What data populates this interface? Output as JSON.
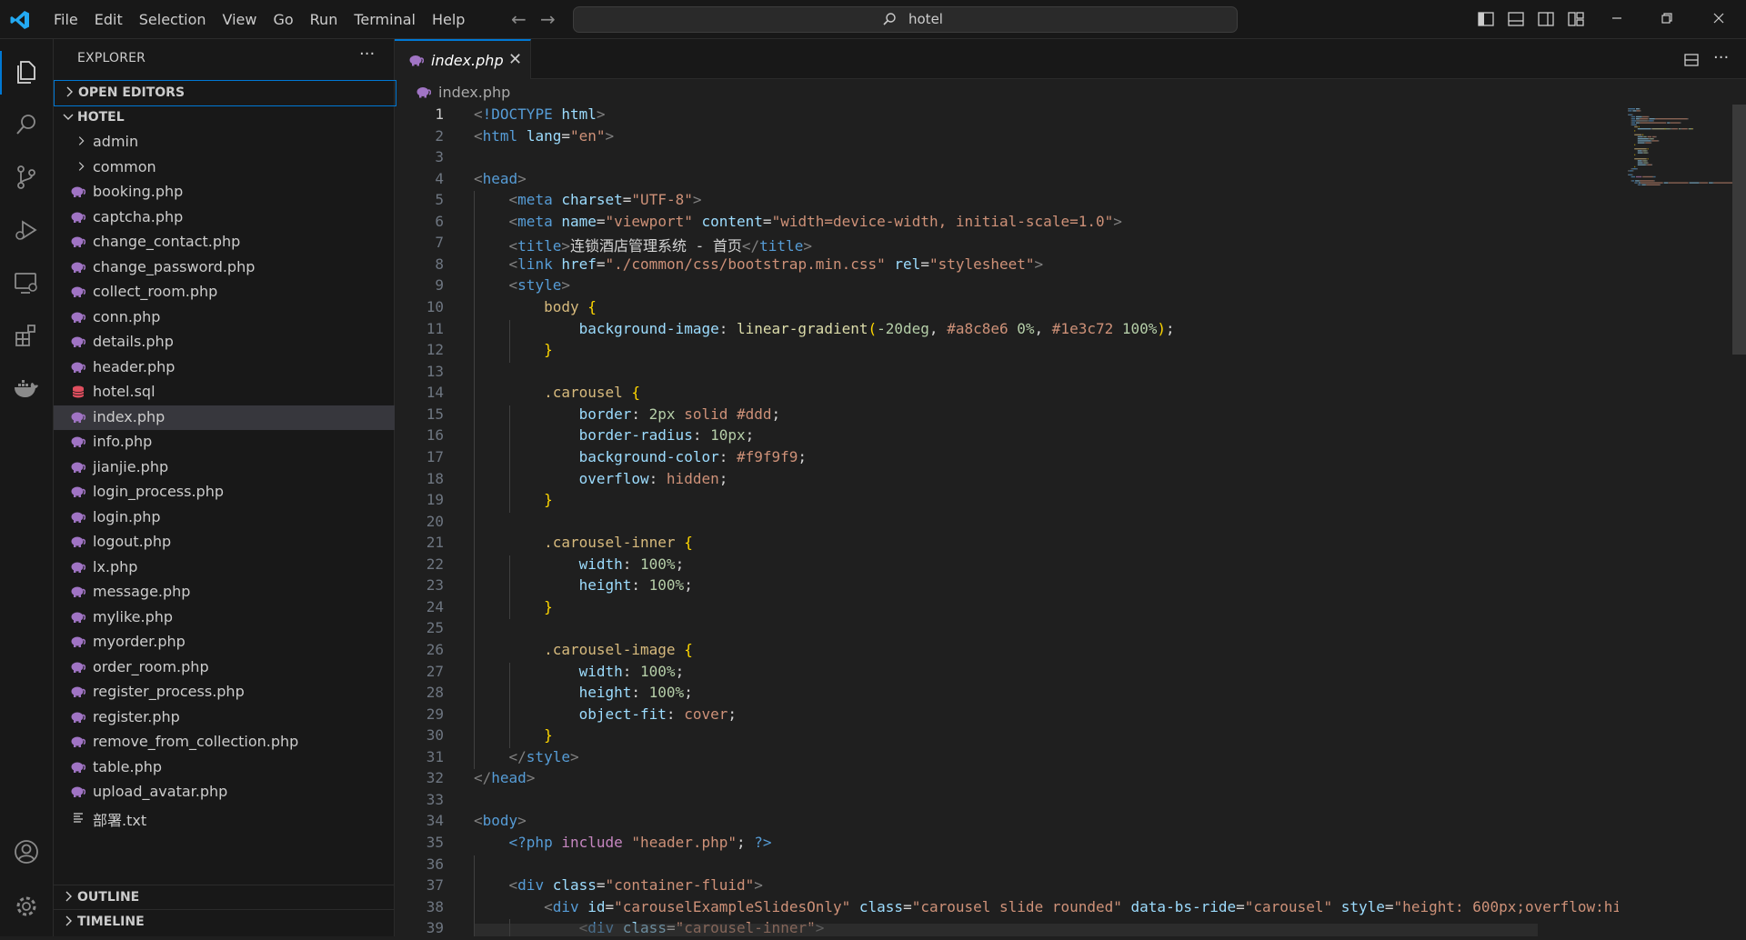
{
  "menu": [
    "File",
    "Edit",
    "Selection",
    "View",
    "Go",
    "Run",
    "Terminal",
    "Help"
  ],
  "search": {
    "text": "hotel"
  },
  "sidebar": {
    "title": "EXPLORER",
    "open_editors": "OPEN EDITORS",
    "root": "HOTEL",
    "folders": [
      "admin",
      "common"
    ],
    "files": [
      {
        "name": "booking.php",
        "type": "php"
      },
      {
        "name": "captcha.php",
        "type": "php"
      },
      {
        "name": "change_contact.php",
        "type": "php"
      },
      {
        "name": "change_password.php",
        "type": "php"
      },
      {
        "name": "collect_room.php",
        "type": "php"
      },
      {
        "name": "conn.php",
        "type": "php"
      },
      {
        "name": "details.php",
        "type": "php"
      },
      {
        "name": "header.php",
        "type": "php"
      },
      {
        "name": "hotel.sql",
        "type": "sql"
      },
      {
        "name": "index.php",
        "type": "php",
        "selected": true
      },
      {
        "name": "info.php",
        "type": "php"
      },
      {
        "name": "jianjie.php",
        "type": "php"
      },
      {
        "name": "login_process.php",
        "type": "php"
      },
      {
        "name": "login.php",
        "type": "php"
      },
      {
        "name": "logout.php",
        "type": "php"
      },
      {
        "name": "lx.php",
        "type": "php"
      },
      {
        "name": "message.php",
        "type": "php"
      },
      {
        "name": "mylike.php",
        "type": "php"
      },
      {
        "name": "myorder.php",
        "type": "php"
      },
      {
        "name": "order_room.php",
        "type": "php"
      },
      {
        "name": "register_process.php",
        "type": "php"
      },
      {
        "name": "register.php",
        "type": "php"
      },
      {
        "name": "remove_from_collection.php",
        "type": "php"
      },
      {
        "name": "table.php",
        "type": "php"
      },
      {
        "name": "upload_avatar.php",
        "type": "php"
      },
      {
        "name": "部署.txt",
        "type": "txt"
      }
    ],
    "outline": "OUTLINE",
    "timeline": "TIMELINE"
  },
  "tab": {
    "label": "index.php"
  },
  "breadcrumb": "index.php",
  "editor": {
    "current_line": 1,
    "lines": [
      [
        [
          "br",
          "<"
        ],
        [
          "tag",
          "!DOCTYPE"
        ],
        [
          "pl",
          " "
        ],
        [
          "attr",
          "html"
        ],
        [
          "br",
          ">"
        ]
      ],
      [
        [
          "br",
          "<"
        ],
        [
          "tag",
          "html"
        ],
        [
          "pl",
          " "
        ],
        [
          "attr",
          "lang"
        ],
        [
          "pl",
          "="
        ],
        [
          "str",
          "\"en\""
        ],
        [
          "br",
          ">"
        ]
      ],
      [],
      [
        [
          "br",
          "<"
        ],
        [
          "tag",
          "head"
        ],
        [
          "br",
          ">"
        ]
      ],
      [
        [
          "pl",
          "    "
        ],
        [
          "br",
          "<"
        ],
        [
          "tag",
          "meta"
        ],
        [
          "pl",
          " "
        ],
        [
          "attr",
          "charset"
        ],
        [
          "pl",
          "="
        ],
        [
          "str",
          "\"UTF-8\""
        ],
        [
          "br",
          ">"
        ]
      ],
      [
        [
          "pl",
          "    "
        ],
        [
          "br",
          "<"
        ],
        [
          "tag",
          "meta"
        ],
        [
          "pl",
          " "
        ],
        [
          "attr",
          "name"
        ],
        [
          "pl",
          "="
        ],
        [
          "str",
          "\"viewport\""
        ],
        [
          "pl",
          " "
        ],
        [
          "attr",
          "content"
        ],
        [
          "pl",
          "="
        ],
        [
          "str",
          "\"width=device-width, initial-scale=1.0\""
        ],
        [
          "br",
          ">"
        ]
      ],
      [
        [
          "pl",
          "    "
        ],
        [
          "br",
          "<"
        ],
        [
          "tag",
          "title"
        ],
        [
          "br",
          ">"
        ],
        [
          "pl",
          "连锁酒店管理系统 - 首页"
        ],
        [
          "br",
          "</"
        ],
        [
          "tag",
          "title"
        ],
        [
          "br",
          ">"
        ]
      ],
      [
        [
          "pl",
          "    "
        ],
        [
          "br",
          "<"
        ],
        [
          "tag",
          "link"
        ],
        [
          "pl",
          " "
        ],
        [
          "attr",
          "href"
        ],
        [
          "pl",
          "="
        ],
        [
          "str",
          "\"./common/css/bootstrap.min.css\""
        ],
        [
          "pl",
          " "
        ],
        [
          "attr",
          "rel"
        ],
        [
          "pl",
          "="
        ],
        [
          "str",
          "\"stylesheet\""
        ],
        [
          "br",
          ">"
        ]
      ],
      [
        [
          "pl",
          "    "
        ],
        [
          "br",
          "<"
        ],
        [
          "tag",
          "style"
        ],
        [
          "br",
          ">"
        ]
      ],
      [
        [
          "pl",
          "        "
        ],
        [
          "sel",
          "body"
        ],
        [
          "pl",
          " "
        ],
        [
          "brace",
          "{"
        ]
      ],
      [
        [
          "pl",
          "            "
        ],
        [
          "attr",
          "background-image"
        ],
        [
          "pl",
          ": "
        ],
        [
          "fn",
          "linear-gradient"
        ],
        [
          "brace",
          "("
        ],
        [
          "num",
          "-20deg"
        ],
        [
          "pl",
          ", "
        ],
        [
          "str",
          "#a8c8e6"
        ],
        [
          "pl",
          " "
        ],
        [
          "num",
          "0%"
        ],
        [
          "pl",
          ", "
        ],
        [
          "str",
          "#1e3c72"
        ],
        [
          "pl",
          " "
        ],
        [
          "num",
          "100%"
        ],
        [
          "brace",
          ")"
        ],
        [
          "pl",
          ";"
        ]
      ],
      [
        [
          "pl",
          "        "
        ],
        [
          "brace",
          "}"
        ]
      ],
      [],
      [
        [
          "pl",
          "        "
        ],
        [
          "sel",
          ".carousel"
        ],
        [
          "pl",
          " "
        ],
        [
          "brace",
          "{"
        ]
      ],
      [
        [
          "pl",
          "            "
        ],
        [
          "attr",
          "border"
        ],
        [
          "pl",
          ": "
        ],
        [
          "num",
          "2px"
        ],
        [
          "pl",
          " "
        ],
        [
          "str",
          "solid"
        ],
        [
          "pl",
          " "
        ],
        [
          "str",
          "#ddd"
        ],
        [
          "pl",
          ";"
        ]
      ],
      [
        [
          "pl",
          "            "
        ],
        [
          "attr",
          "border-radius"
        ],
        [
          "pl",
          ": "
        ],
        [
          "num",
          "10px"
        ],
        [
          "pl",
          ";"
        ]
      ],
      [
        [
          "pl",
          "            "
        ],
        [
          "attr",
          "background-color"
        ],
        [
          "pl",
          ": "
        ],
        [
          "str",
          "#f9f9f9"
        ],
        [
          "pl",
          ";"
        ]
      ],
      [
        [
          "pl",
          "            "
        ],
        [
          "attr",
          "overflow"
        ],
        [
          "pl",
          ": "
        ],
        [
          "str",
          "hidden"
        ],
        [
          "pl",
          ";"
        ]
      ],
      [
        [
          "pl",
          "        "
        ],
        [
          "brace",
          "}"
        ]
      ],
      [],
      [
        [
          "pl",
          "        "
        ],
        [
          "sel",
          ".carousel-inner"
        ],
        [
          "pl",
          " "
        ],
        [
          "brace",
          "{"
        ]
      ],
      [
        [
          "pl",
          "            "
        ],
        [
          "attr",
          "width"
        ],
        [
          "pl",
          ": "
        ],
        [
          "num",
          "100%"
        ],
        [
          "pl",
          ";"
        ]
      ],
      [
        [
          "pl",
          "            "
        ],
        [
          "attr",
          "height"
        ],
        [
          "pl",
          ": "
        ],
        [
          "num",
          "100%"
        ],
        [
          "pl",
          ";"
        ]
      ],
      [
        [
          "pl",
          "        "
        ],
        [
          "brace",
          "}"
        ]
      ],
      [],
      [
        [
          "pl",
          "        "
        ],
        [
          "sel",
          ".carousel-image"
        ],
        [
          "pl",
          " "
        ],
        [
          "brace",
          "{"
        ]
      ],
      [
        [
          "pl",
          "            "
        ],
        [
          "attr",
          "width"
        ],
        [
          "pl",
          ": "
        ],
        [
          "num",
          "100%"
        ],
        [
          "pl",
          ";"
        ]
      ],
      [
        [
          "pl",
          "            "
        ],
        [
          "attr",
          "height"
        ],
        [
          "pl",
          ": "
        ],
        [
          "num",
          "100%"
        ],
        [
          "pl",
          ";"
        ]
      ],
      [
        [
          "pl",
          "            "
        ],
        [
          "attr",
          "object-fit"
        ],
        [
          "pl",
          ": "
        ],
        [
          "str",
          "cover"
        ],
        [
          "pl",
          ";"
        ]
      ],
      [
        [
          "pl",
          "        "
        ],
        [
          "brace",
          "}"
        ]
      ],
      [
        [
          "pl",
          "    "
        ],
        [
          "br",
          "</"
        ],
        [
          "tag",
          "style"
        ],
        [
          "br",
          ">"
        ]
      ],
      [
        [
          "br",
          "</"
        ],
        [
          "tag",
          "head"
        ],
        [
          "br",
          ">"
        ]
      ],
      [],
      [
        [
          "br",
          "<"
        ],
        [
          "tag",
          "body"
        ],
        [
          "br",
          ">"
        ]
      ],
      [
        [
          "pl",
          "    "
        ],
        [
          "php",
          "<?php"
        ],
        [
          "pl",
          " "
        ],
        [
          "kw",
          "include"
        ],
        [
          "pl",
          " "
        ],
        [
          "str",
          "\"header.php\""
        ],
        [
          "pl",
          "; "
        ],
        [
          "php",
          "?>"
        ]
      ],
      [],
      [
        [
          "pl",
          "    "
        ],
        [
          "br",
          "<"
        ],
        [
          "tag",
          "div"
        ],
        [
          "pl",
          " "
        ],
        [
          "attr",
          "class"
        ],
        [
          "pl",
          "="
        ],
        [
          "str",
          "\"container-fluid\""
        ],
        [
          "br",
          ">"
        ]
      ],
      [
        [
          "pl",
          "        "
        ],
        [
          "br",
          "<"
        ],
        [
          "tag",
          "div"
        ],
        [
          "pl",
          " "
        ],
        [
          "attr",
          "id"
        ],
        [
          "pl",
          "="
        ],
        [
          "str",
          "\"carouselExampleSlidesOnly\""
        ],
        [
          "pl",
          " "
        ],
        [
          "attr",
          "class"
        ],
        [
          "pl",
          "="
        ],
        [
          "str",
          "\"carousel slide rounded\""
        ],
        [
          "pl",
          " "
        ],
        [
          "attr",
          "data-bs-ride"
        ],
        [
          "pl",
          "="
        ],
        [
          "str",
          "\"carousel\""
        ],
        [
          "pl",
          " "
        ],
        [
          "attr",
          "style"
        ],
        [
          "pl",
          "="
        ],
        [
          "str",
          "\"height: 600px;overflow:hi"
        ]
      ],
      [
        [
          "pl",
          "            "
        ],
        [
          "br",
          "<"
        ],
        [
          "tag",
          "div"
        ],
        [
          "pl",
          " "
        ],
        [
          "attr",
          "class"
        ],
        [
          "pl",
          "="
        ],
        [
          "str",
          "\"carousel-inner\""
        ],
        [
          "br",
          ">"
        ]
      ]
    ]
  },
  "colors": {
    "accent": "#0078d4",
    "php_icon": "#a074c4",
    "sql_icon": "#e04f5f"
  }
}
